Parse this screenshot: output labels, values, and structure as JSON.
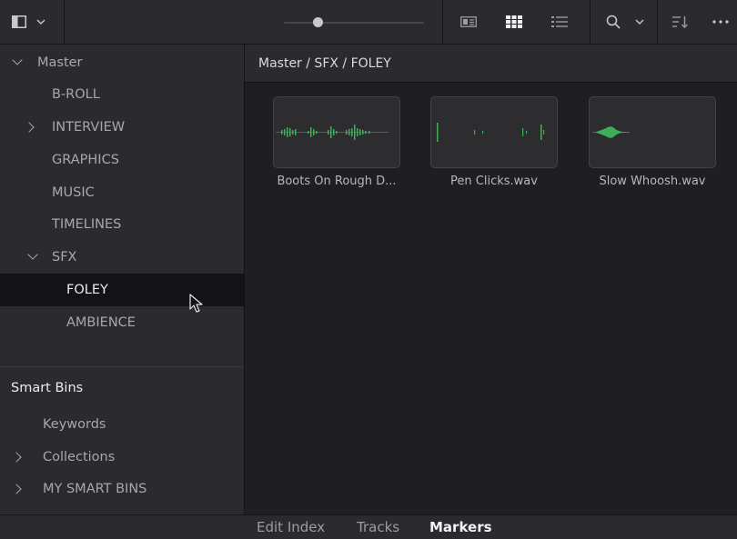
{
  "toolbar": {
    "icons": [
      "panel-toggle-icon",
      "chevron-down-icon",
      "thumbnail-size-slider",
      "metadata-view-icon",
      "thumbnail-view-icon",
      "list-view-icon",
      "search-icon",
      "chevron-down-icon",
      "sort-icon",
      "more-options-icon"
    ],
    "active_view": "thumbnail",
    "slider_level": 0.2
  },
  "sidebar": {
    "root": "Master",
    "bins": [
      {
        "label": "B-ROLL"
      },
      {
        "label": "INTERVIEW"
      },
      {
        "label": "GRAPHICS"
      },
      {
        "label": "MUSIC"
      },
      {
        "label": "TIMELINES"
      },
      {
        "label": "SFX"
      },
      {
        "label": "FOLEY"
      },
      {
        "label": "AMBIENCE"
      }
    ],
    "selected": "FOLEY",
    "smart_bins_title": "Smart Bins",
    "smart_bins": [
      {
        "label": "Keywords"
      },
      {
        "label": "Collections"
      },
      {
        "label": "MY SMART BINS"
      }
    ]
  },
  "breadcrumb": "Master / SFX / FOLEY",
  "clips": [
    {
      "name": "Boots On Rough D..."
    },
    {
      "name": "Pen Clicks.wav"
    },
    {
      "name": "Slow Whoosh.wav"
    }
  ],
  "bottom_tabs": [
    {
      "label": "Edit Index"
    },
    {
      "label": "Tracks"
    },
    {
      "label": "Markers"
    }
  ],
  "active_tab": "Markers",
  "colors": {
    "waveform": "#3fae5a",
    "panel_bg": "#2b2b2e",
    "content_bg": "#1f1f22",
    "selected_bg": "#131315"
  }
}
